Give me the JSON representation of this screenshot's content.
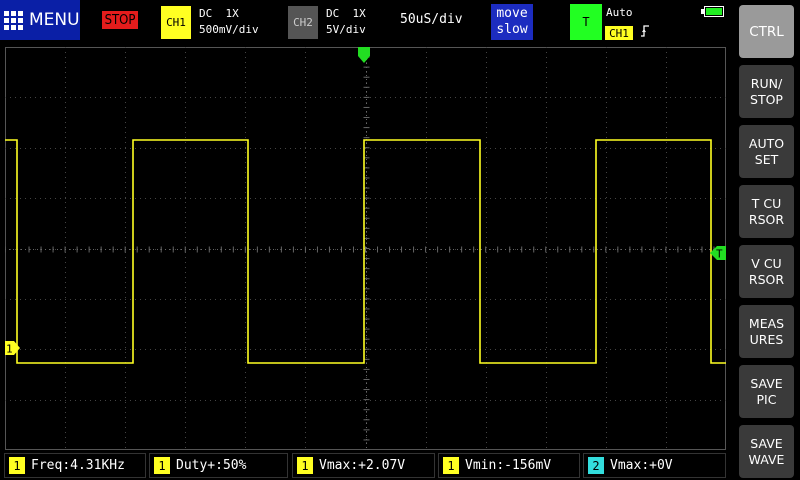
{
  "topbar": {
    "menu_label": "MENU",
    "run_state": "STOP",
    "ch1": {
      "badge": "CH1",
      "coupling": "DC  1X",
      "scale": "500mV/div"
    },
    "ch2": {
      "badge": "CH2",
      "coupling": "DC  1X",
      "scale": "5V/div"
    },
    "timebase": "50uS/div",
    "move_line1": "move",
    "move_line2": "slow",
    "trigger": {
      "badge": "T",
      "mode": "Auto",
      "source": "CH1",
      "edge_icon": "rising-edge-icon"
    }
  },
  "sidebar": {
    "buttons": [
      {
        "id": "ctrl",
        "label": "CTRL"
      },
      {
        "id": "run-stop",
        "label": "RUN/\nSTOP"
      },
      {
        "id": "auto-set",
        "label": "AUTO\nSET"
      },
      {
        "id": "t-cursor",
        "label": "T CU\nRSOR"
      },
      {
        "id": "v-cursor",
        "label": "V CU\nRSOR"
      },
      {
        "id": "measures",
        "label": "MEAS\nURES"
      },
      {
        "id": "save-pic",
        "label": "SAVE\nPIC"
      },
      {
        "id": "save-wave",
        "label": "SAVE\nWAVE"
      }
    ]
  },
  "screen": {
    "ch1_marker": "1",
    "trigger_marker": "T"
  },
  "measurements": [
    {
      "ch": "1",
      "label": "Freq",
      "value": "4.31KHz"
    },
    {
      "ch": "1",
      "label": "Duty+",
      "value": "50%"
    },
    {
      "ch": "1",
      "label": "Vmax",
      "value": "+2.07V"
    },
    {
      "ch": "1",
      "label": "Vmin",
      "value": "-156mV"
    },
    {
      "ch": "2",
      "label": "Vmax",
      "value": "+0V"
    }
  ],
  "colors": {
    "ch1": "#ffff22",
    "ch2": "#33dddd",
    "trigger": "#22ff22",
    "stop": "#e41c1c"
  }
}
